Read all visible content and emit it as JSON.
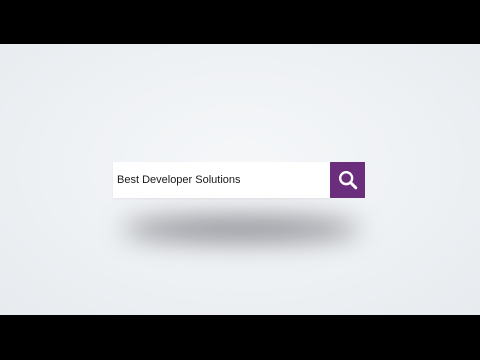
{
  "search": {
    "value": "Best Developer Solutions",
    "button_icon": "search-icon"
  },
  "colors": {
    "button_bg": "#6a2e7d",
    "background": "#eef1f4",
    "letterbox": "#000000"
  }
}
